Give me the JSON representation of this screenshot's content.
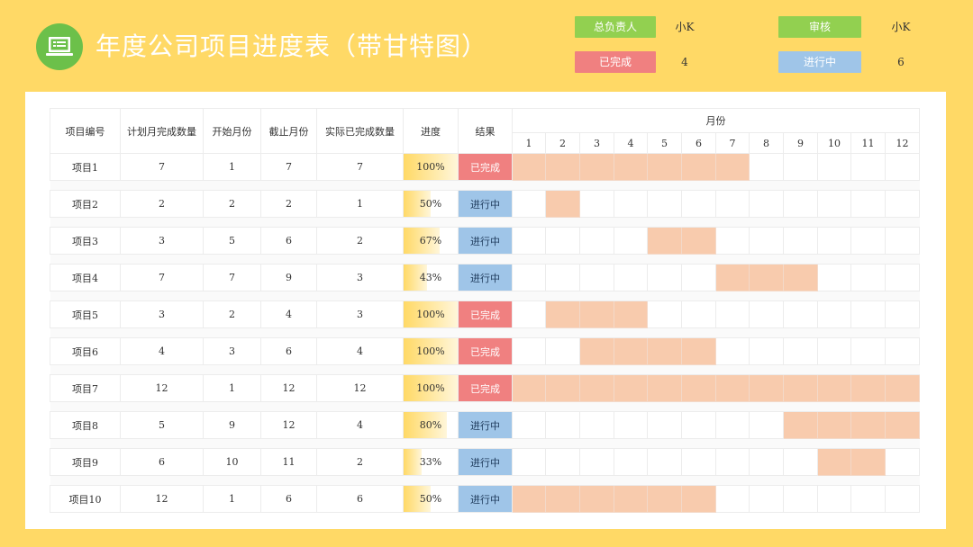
{
  "header": {
    "title": "年度公司项目进度表（带甘特图）",
    "icon": "laptop-icon",
    "legend": {
      "owner_label": "总负责人",
      "owner_value": "小K",
      "reviewer_label": "审核",
      "reviewer_value": "小K",
      "done_label": "已完成",
      "done_count": "4",
      "doing_label": "进行中",
      "doing_count": "6"
    }
  },
  "colors": {
    "background": "#FFD966",
    "green_button": "#92D050",
    "done": "#F08080",
    "doing": "#9FC5E8",
    "gantt_bar": "#F8CBAD",
    "progress": "#FFD966"
  },
  "table": {
    "headers": {
      "id": "项目编号",
      "planned": "计划月完成数量",
      "start": "开始月份",
      "end": "截止月份",
      "actual": "实际已完成数量",
      "progress": "进度",
      "result": "结果",
      "months_title": "月份"
    },
    "months": [
      "1",
      "2",
      "3",
      "4",
      "5",
      "6",
      "7",
      "8",
      "9",
      "10",
      "11",
      "12"
    ],
    "rows": [
      {
        "id": "项目1",
        "planned": "7",
        "start": "1",
        "end": "7",
        "actual": "7",
        "progress": "100%",
        "progress_value": 1.0,
        "result": "已完成",
        "status": "done",
        "bar_start": 1,
        "bar_end": 7
      },
      {
        "id": "项目2",
        "planned": "2",
        "start": "2",
        "end": "2",
        "actual": "1",
        "progress": "50%",
        "progress_value": 0.5,
        "result": "进行中",
        "status": "doing",
        "bar_start": 2,
        "bar_end": 2
      },
      {
        "id": "项目3",
        "planned": "3",
        "start": "5",
        "end": "6",
        "actual": "2",
        "progress": "67%",
        "progress_value": 0.67,
        "result": "进行中",
        "status": "doing",
        "bar_start": 5,
        "bar_end": 6
      },
      {
        "id": "项目4",
        "planned": "7",
        "start": "7",
        "end": "9",
        "actual": "3",
        "progress": "43%",
        "progress_value": 0.43,
        "result": "进行中",
        "status": "doing",
        "bar_start": 7,
        "bar_end": 9
      },
      {
        "id": "项目5",
        "planned": "3",
        "start": "2",
        "end": "4",
        "actual": "3",
        "progress": "100%",
        "progress_value": 1.0,
        "result": "已完成",
        "status": "done",
        "bar_start": 2,
        "bar_end": 4
      },
      {
        "id": "项目6",
        "planned": "4",
        "start": "3",
        "end": "6",
        "actual": "4",
        "progress": "100%",
        "progress_value": 1.0,
        "result": "已完成",
        "status": "done",
        "bar_start": 3,
        "bar_end": 6
      },
      {
        "id": "项目7",
        "planned": "12",
        "start": "1",
        "end": "12",
        "actual": "12",
        "progress": "100%",
        "progress_value": 1.0,
        "result": "已完成",
        "status": "done",
        "bar_start": 1,
        "bar_end": 12
      },
      {
        "id": "项目8",
        "planned": "5",
        "start": "9",
        "end": "12",
        "actual": "4",
        "progress": "80%",
        "progress_value": 0.8,
        "result": "进行中",
        "status": "doing",
        "bar_start": 9,
        "bar_end": 12
      },
      {
        "id": "项目9",
        "planned": "6",
        "start": "10",
        "end": "11",
        "actual": "2",
        "progress": "33%",
        "progress_value": 0.33,
        "result": "进行中",
        "status": "doing",
        "bar_start": 10,
        "bar_end": 11
      },
      {
        "id": "项目10",
        "planned": "12",
        "start": "1",
        "end": "6",
        "actual": "6",
        "progress": "50%",
        "progress_value": 0.5,
        "result": "进行中",
        "status": "doing",
        "bar_start": 1,
        "bar_end": 6
      }
    ]
  }
}
